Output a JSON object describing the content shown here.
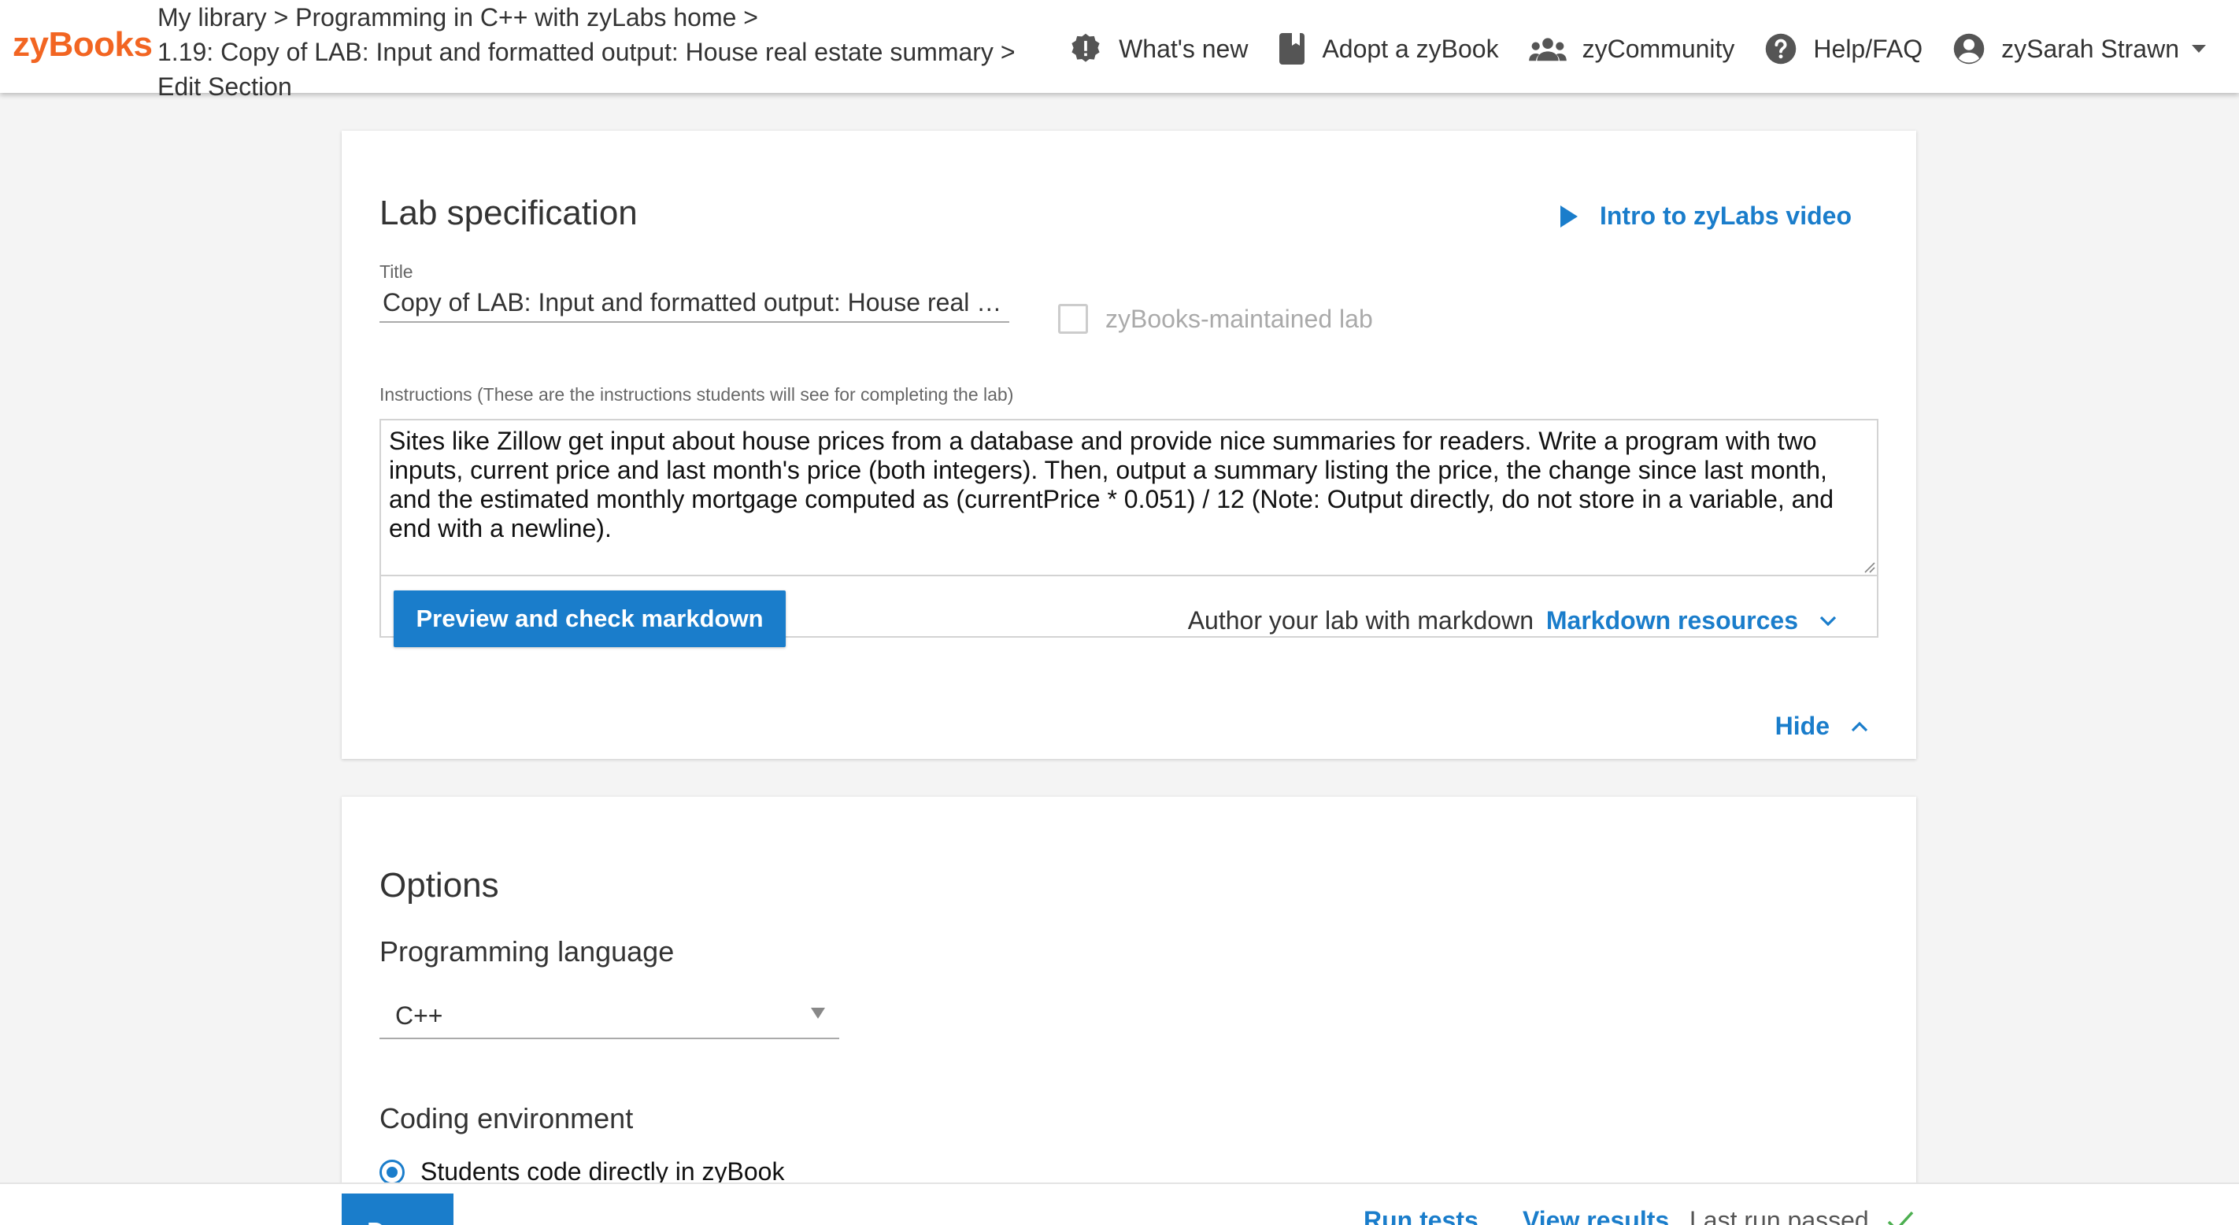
{
  "app": {
    "logo": "zyBooks"
  },
  "breadcrumb": {
    "line1": "My library > Programming in C++ with zyLabs home >",
    "line2": "1.19: Copy of LAB: Input and formatted output: House real estate summary >",
    "line3": "Edit Section"
  },
  "nav": {
    "whats_new": "What's new",
    "adopt": "Adopt a zyBook",
    "community": "zyCommunity",
    "help": "Help/FAQ",
    "user": "zySarah Strawn"
  },
  "lab_spec": {
    "heading": "Lab specification",
    "intro_video": "Intro to zyLabs video",
    "title_label": "Title",
    "title_value": "Copy of LAB: Input and formatted output: House real estate summary",
    "maintained_label": "zyBooks-maintained lab",
    "instructions_label": "Instructions (These are the instructions students will see for completing the lab)",
    "instructions_text": "Sites like Zillow get input about house prices from a database and provide nice summaries for readers. Write a program with two inputs, current price and last month's price (both integers). Then, output a summary listing the price, the change since last month, and the estimated monthly mortgage computed as (currentPrice * 0.051) / 12 (Note: Output directly, do not store in a variable, and end with a newline).",
    "preview_button": "Preview and check markdown",
    "author_hint": "Author your lab with markdown",
    "markdown_resources": "Markdown resources",
    "hide": "Hide"
  },
  "options": {
    "heading": "Options",
    "language_label": "Programming language",
    "language_value": "C++",
    "env_label": "Coding environment",
    "env_option": "Students code directly in zyBook"
  },
  "footer": {
    "done": "Done",
    "run_tests": "Run tests",
    "view_results": "View results",
    "last_run": "Last run passed"
  },
  "colors": {
    "brand": "#f26522",
    "accent": "#1a7dcb",
    "success": "#4caf50"
  }
}
